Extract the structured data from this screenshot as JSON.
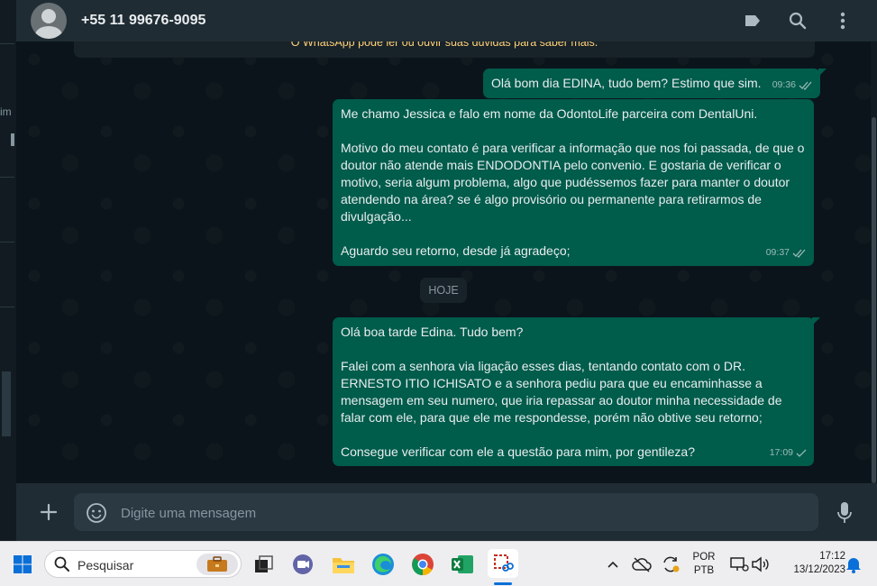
{
  "header": {
    "contact_name": "+55 11 99676-9095"
  },
  "left_strip": {
    "partial_text": "im"
  },
  "system_notice": {
    "text": "O WhatsApp pode ler ou ouvir suas dúvidas para saber mais."
  },
  "messages": [
    {
      "text": "Olá bom dia EDINA, tudo bem? Estimo que sim.",
      "time": "09:36",
      "status": "read"
    },
    {
      "text": "Me chamo Jessica e falo em nome da OdontoLife parceira com DentalUni.\n\nMotivo do meu contato é para verificar a informação que nos foi passada, de que o doutor não atende mais ENDODONTIA pelo convenio. E gostaria de verificar o motivo, seria algum problema, algo que pudéssemos fazer para manter o doutor atendendo na área? se é algo provisório ou permanente para retirarmos de divulgação...\n\nAguardo seu retorno, desde já agradeço;",
      "time": "09:37",
      "status": "read"
    },
    {
      "text": "Olá boa tarde Edina. Tudo bem?\n\nFalei com a senhora via ligação esses dias, tentando contato com o DR.  ERNESTO ITIO ICHISATO e a senhora pediu para que eu encaminhasse a mensagem em seu numero, que iria repassar ao doutor minha necessidade de falar com ele, para que ele me respondesse, porém não obtive seu retorno;\n\nConsegue verificar com ele a questão para mim, por gentileza?",
      "time": "17:09",
      "status": "sent"
    }
  ],
  "date_divider": "HOJE",
  "composer": {
    "placeholder": "Digite uma mensagem"
  },
  "taskbar": {
    "search_placeholder": "Pesquisar",
    "language_line1": "POR",
    "language_line2": "PTB",
    "time": "17:12",
    "date": "13/12/2023"
  },
  "colors": {
    "outgoing_bubble": "#005c4b",
    "chat_background": "#0b141a",
    "header_background": "#202c33"
  }
}
